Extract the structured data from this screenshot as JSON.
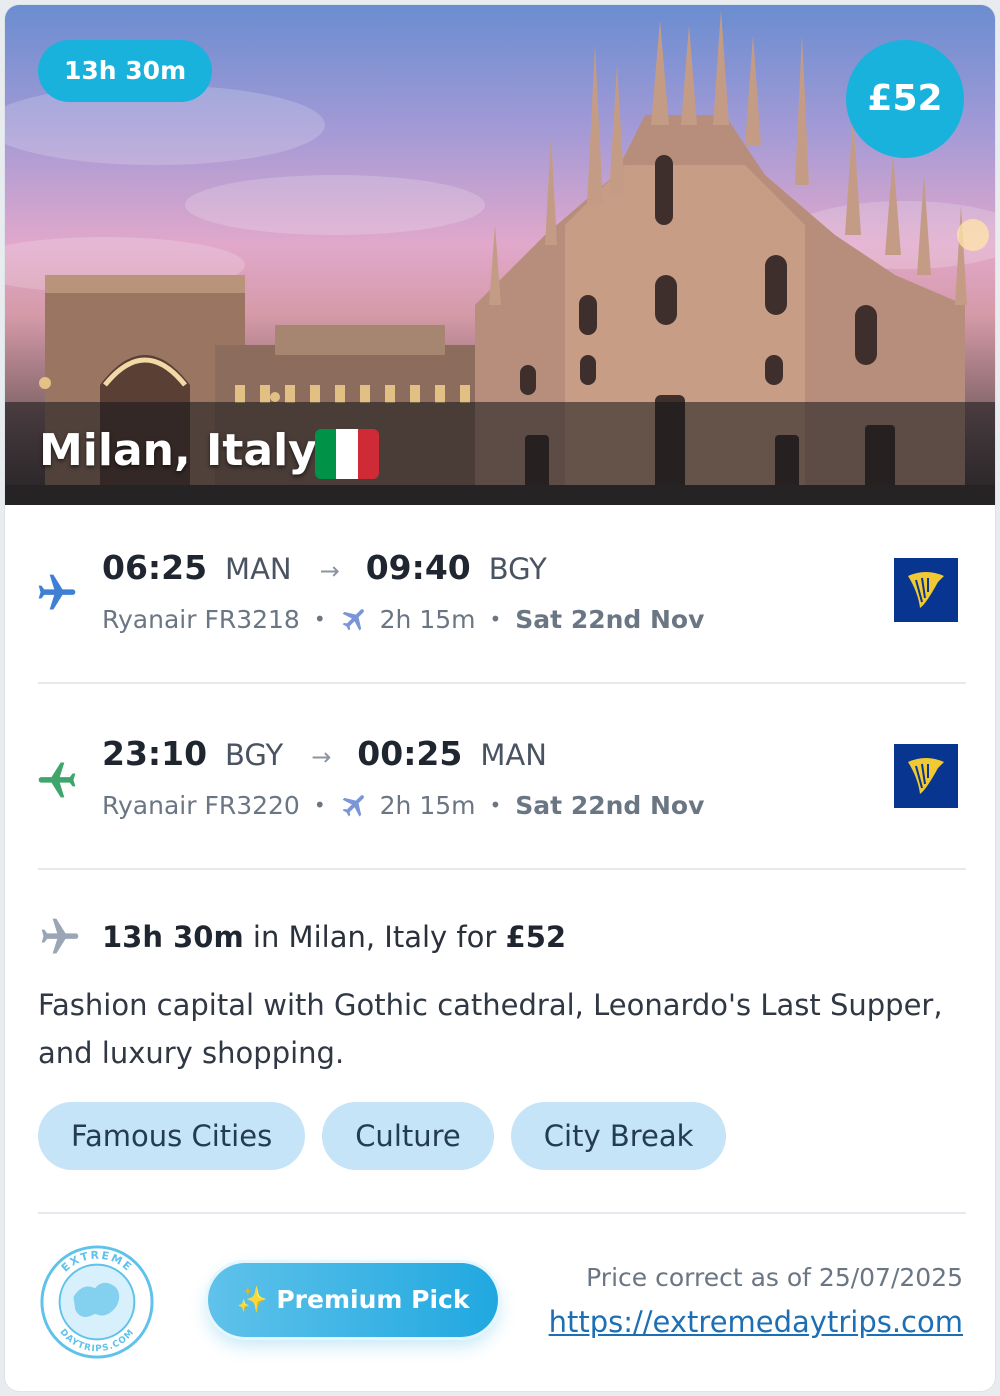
{
  "hero": {
    "duration_badge": "13h 30m",
    "price_badge": "£52",
    "destination": "Milan, Italy",
    "flag": {
      "icon": "italy-flag-icon",
      "colors": [
        "#009246",
        "#ffffff",
        "#ce2b37"
      ]
    }
  },
  "outbound": {
    "depart_time": "06:25",
    "depart_code": "MAN",
    "arrow": "→",
    "arrive_time": "09:40",
    "arrive_code": "BGY",
    "flight": "Ryanair FR3218",
    "sep": "•",
    "duration": "2h 15m",
    "date": "Sat 22nd Nov",
    "icon": "plane-takeoff-icon",
    "icon_color": "#3f80d4"
  },
  "return": {
    "depart_time": "23:10",
    "depart_code": "BGY",
    "arrow": "→",
    "arrive_time": "00:25",
    "arrive_code": "MAN",
    "flight": "Ryanair FR3220",
    "sep": "•",
    "duration": "2h 15m",
    "date": "Sat 22nd Nov",
    "icon": "plane-return-icon",
    "icon_color": "#3fa56b"
  },
  "summary": {
    "duration": "13h 30m",
    "in_text": " in Milan, Italy for ",
    "price": "£52"
  },
  "description": "Fashion capital with Gothic cathedral, Leonardo's Last Supper, and luxury shopping.",
  "tags": [
    "Famous Cities",
    "Culture",
    "City Break"
  ],
  "footer": {
    "stamp_text_top": "EXTREME",
    "stamp_text_bottom": "DAYTRIPS.COM",
    "premium_label": "✨ Premium Pick",
    "price_note": "Price correct as of 25/07/2025",
    "link": "https://extremedaytrips.com"
  },
  "colors": {
    "accent": "#19b2dd",
    "airline": "#073590",
    "airline_harp": "#f1c933",
    "tag_bg": "#c5e4f7"
  }
}
